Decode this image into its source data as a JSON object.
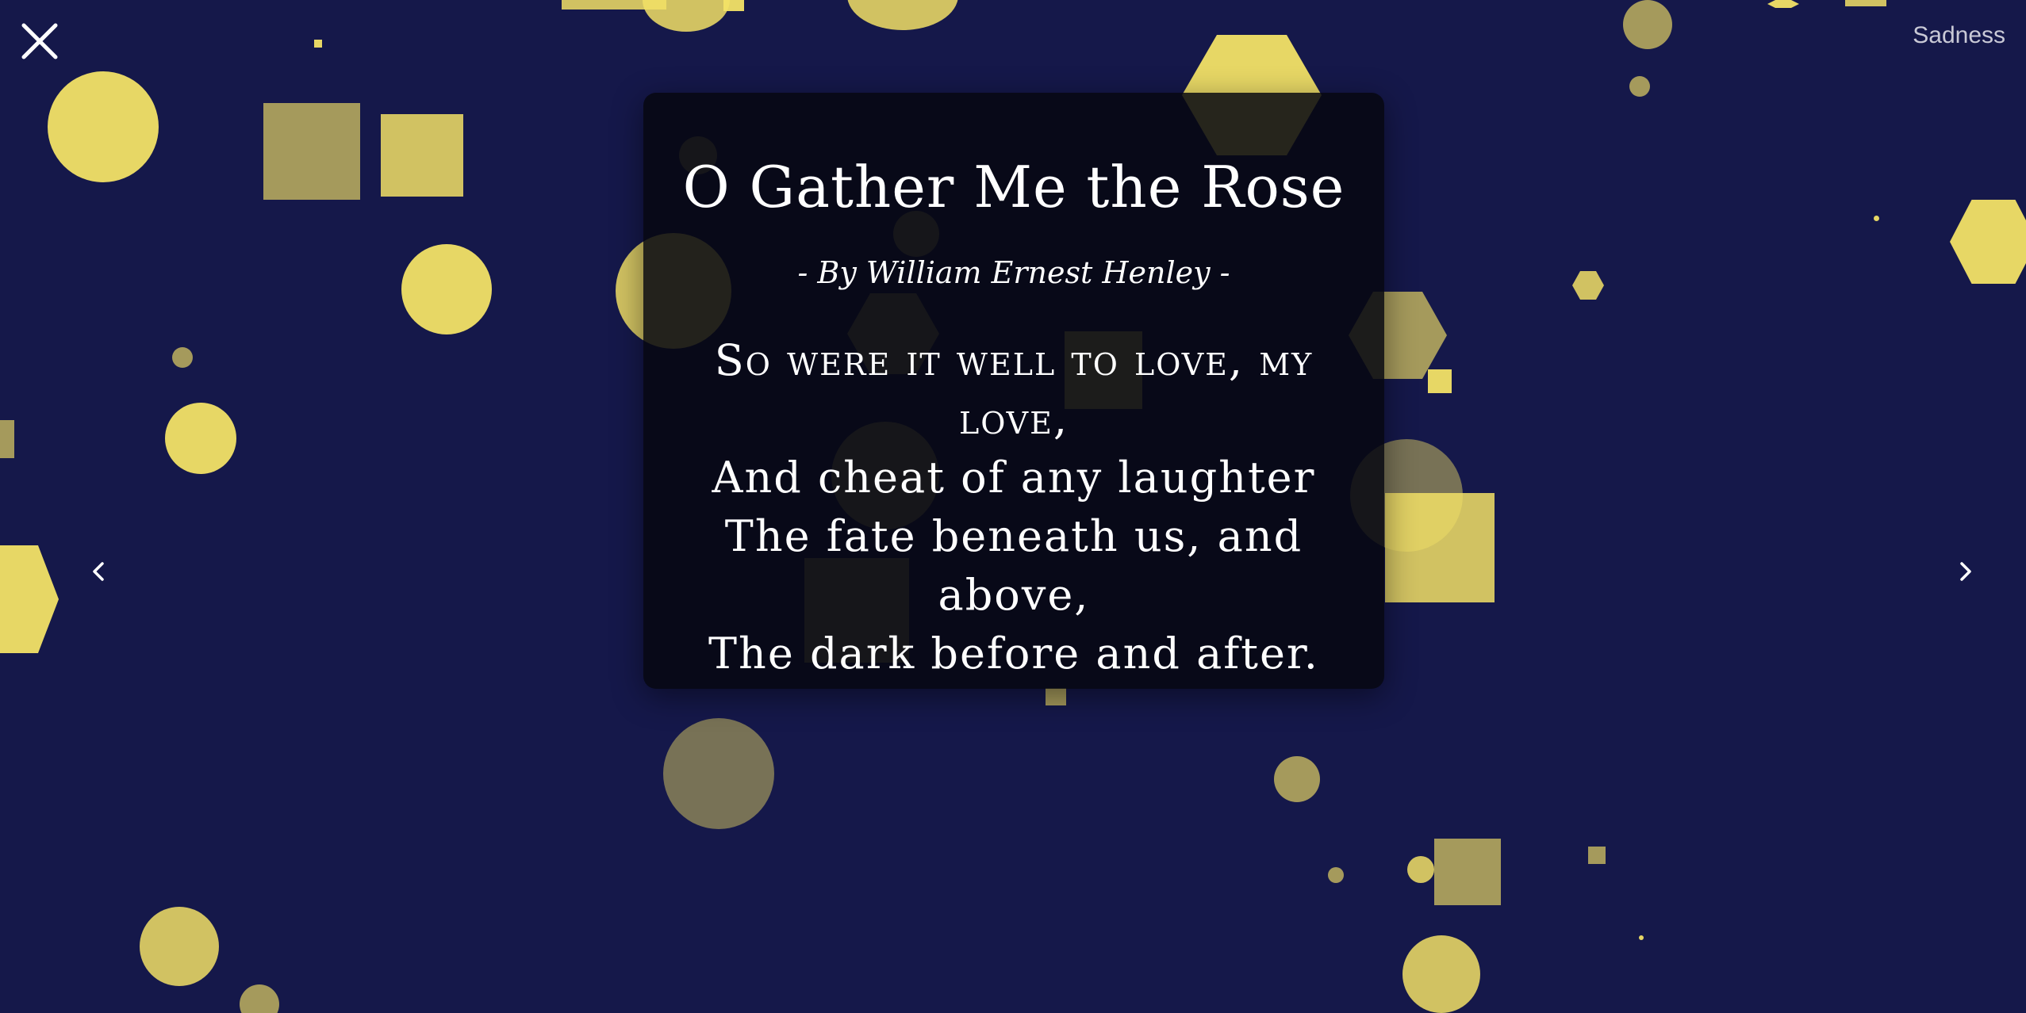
{
  "header": {
    "close_icon": "close-icon",
    "mood_label": "Sadness"
  },
  "navigation": {
    "prev_icon": "chevron-left-icon",
    "next_icon": "chevron-right-icon"
  },
  "poem": {
    "title": "O Gather Me the Rose",
    "author": "- By William Ernest Henley -",
    "lines": [
      "So were it well to love, my love,",
      "And cheat of any laughter",
      "The fate beneath us, and above,",
      "The dark before and after."
    ]
  },
  "colors": {
    "background": "#15184a",
    "shape": "#f2e166",
    "card": "#06070f",
    "text": "#ffffff"
  }
}
